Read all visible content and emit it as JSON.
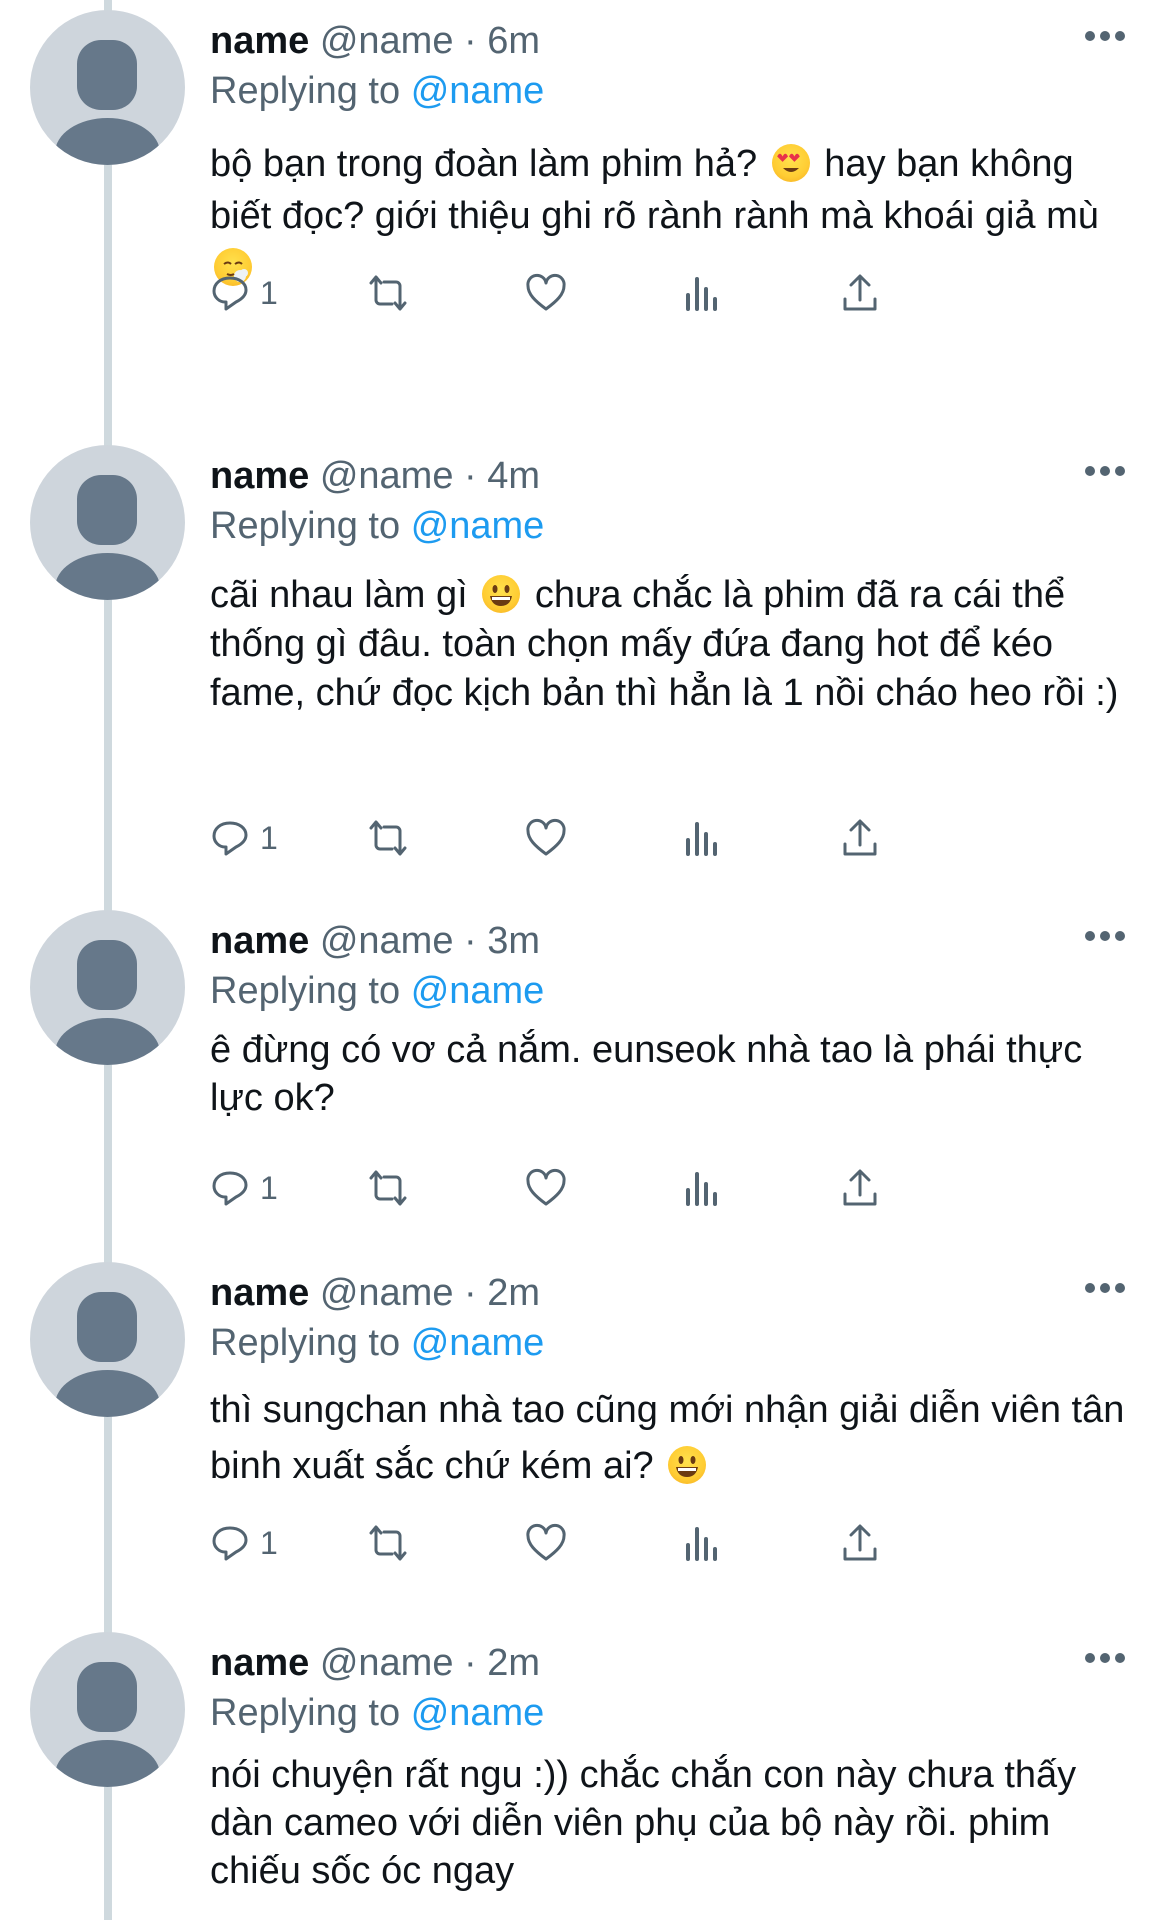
{
  "tweets": [
    {
      "name": "name",
      "handle": "@name",
      "separator": "·",
      "time": "6m",
      "replying_prefix": "Replying to",
      "replying_mention": "@name",
      "text_parts": [
        "bộ bạn trong đoàn làm phim hả?",
        " hay bạn không biết đọc? giới thiệu ghi rõ rành rành mà khoái giả mù",
        ""
      ],
      "emojis": [
        "heart-eyes-emoji",
        "sweat-face-emoji"
      ],
      "reply_count": "1"
    },
    {
      "name": "name",
      "handle": "@name",
      "separator": "·",
      "time": "4m",
      "replying_prefix": "Replying to",
      "replying_mention": "@name",
      "text_parts": [
        "cãi nhau làm gì",
        " chưa chắc là phim đã ra cái thể thống gì đâu. toàn chọn mấy đứa đang hot để kéo fame, chứ đọc kịch bản thì hẳn là 1 nồi cháo heo rồi :)"
      ],
      "emojis": [
        "grinning-face-emoji"
      ],
      "reply_count": "1"
    },
    {
      "name": "name",
      "handle": "@name",
      "separator": "·",
      "time": "3m",
      "replying_prefix": "Replying to",
      "replying_mention": "@name",
      "text_parts": [
        "ê đừng có vơ cả nắm. eunseok nhà tao là phái thực lực ok?"
      ],
      "emojis": [],
      "reply_count": "1"
    },
    {
      "name": "name",
      "handle": "@name",
      "separator": "·",
      "time": "2m",
      "replying_prefix": "Replying to",
      "replying_mention": "@name",
      "text_parts": [
        "thì sungchan nhà tao cũng mới nhận giải diễn viên tân binh xuất sắc chứ kém ai?",
        ""
      ],
      "emojis": [
        "grinning-face-emoji"
      ],
      "reply_count": "1"
    },
    {
      "name": "name",
      "handle": "@name",
      "separator": "·",
      "time": "2m",
      "replying_prefix": "Replying to",
      "replying_mention": "@name",
      "text_parts": [
        "nói chuyện rất ngu :)) chắc chắn con này chưa thấy dàn cameo với diễn viên phụ của bộ này rồi. phim chiếu sốc óc ngay"
      ],
      "emojis": [],
      "reply_count": ""
    }
  ],
  "icons": {
    "reply": "reply-icon",
    "retweet": "retweet-icon",
    "like": "heart-icon",
    "views": "bar-chart-icon",
    "share": "share-icon",
    "more": "more-icon"
  },
  "colors": {
    "text": "#0f1419",
    "secondary": "#536471",
    "link": "#1d9bf0",
    "thread_line": "#cfd9de",
    "avatar_bg": "#ced5dc",
    "avatar_fg": "#66788a"
  }
}
